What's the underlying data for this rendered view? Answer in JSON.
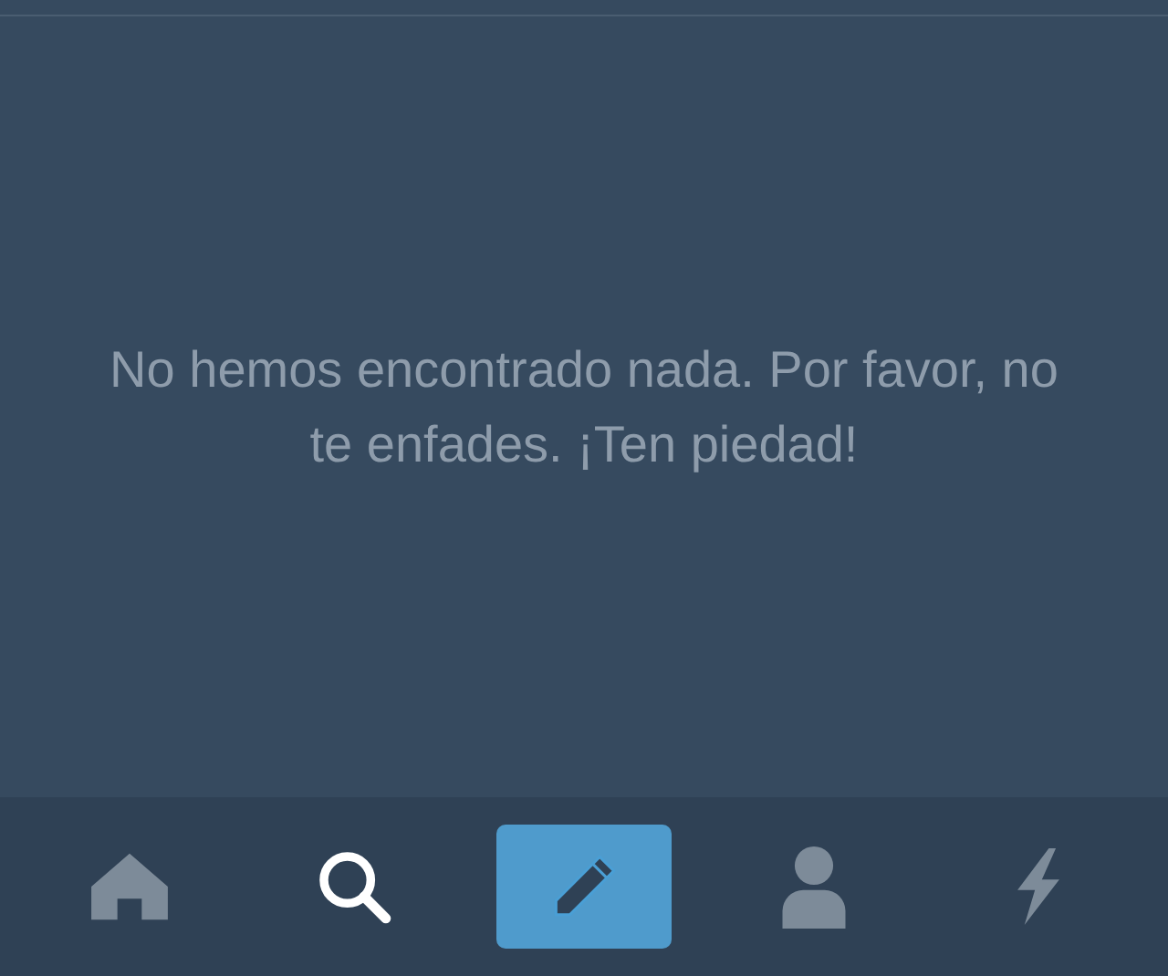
{
  "empty_state": {
    "message": "No hemos encontrado nada. Por favor, no te enfades. ¡Ten piedad!"
  },
  "tab_bar": {
    "items": [
      {
        "kind": "home",
        "selected": false
      },
      {
        "kind": "search",
        "selected": true
      },
      {
        "kind": "compose"
      },
      {
        "kind": "person",
        "selected": false
      },
      {
        "kind": "bolt",
        "selected": false
      }
    ]
  }
}
